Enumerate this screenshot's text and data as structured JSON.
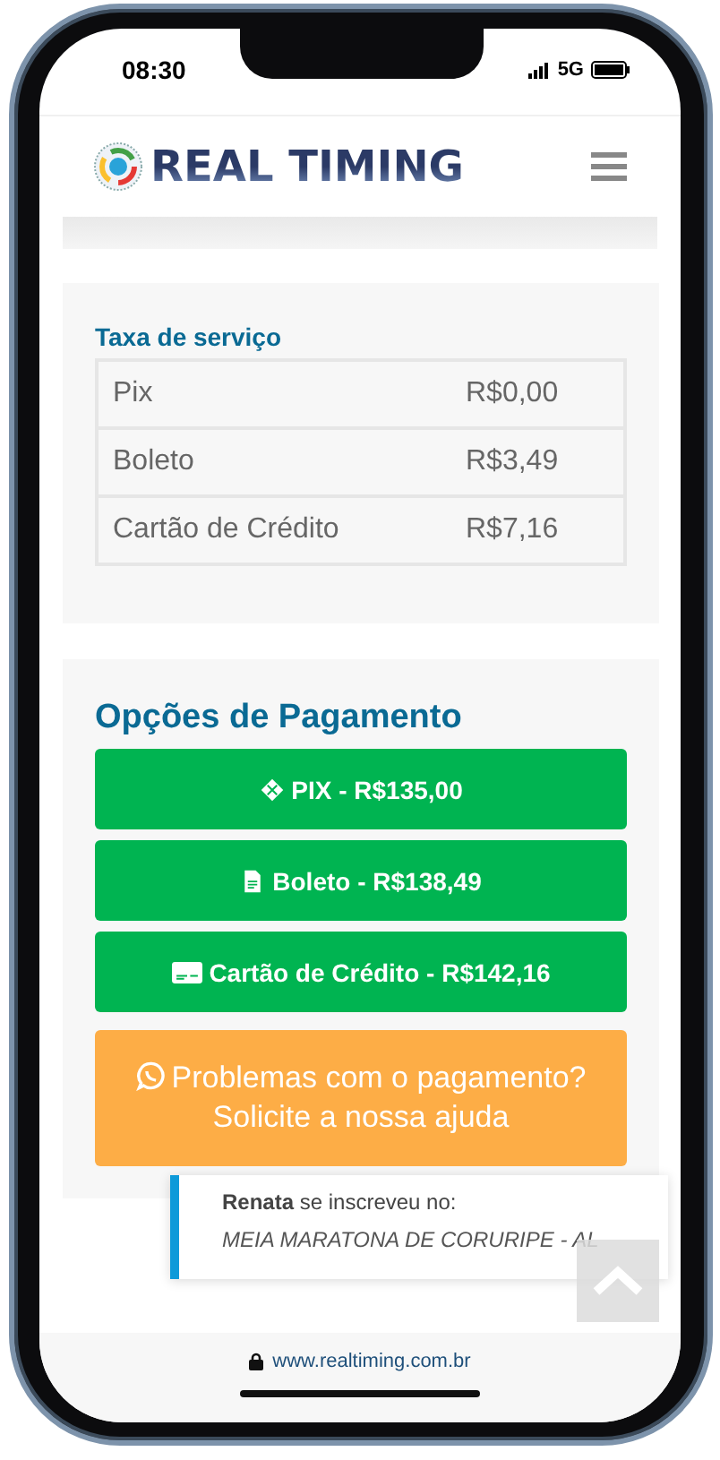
{
  "status_bar": {
    "time": "08:30",
    "network": "5G"
  },
  "header": {
    "logo": "REAL TIMING"
  },
  "service_fees": {
    "title": "Taxa de serviço",
    "rows": [
      {
        "method": "Pix",
        "fee": "R$0,00"
      },
      {
        "method": "Boleto",
        "fee": "R$3,49"
      },
      {
        "method": "Cartão de Crédito",
        "fee": "R$7,16"
      }
    ]
  },
  "payment_options": {
    "title": "Opções de Pagamento",
    "buttons": [
      {
        "kind": "pix",
        "label": "PIX - R$135,00"
      },
      {
        "kind": "boleto",
        "label": "Boleto - R$138,49"
      },
      {
        "kind": "card",
        "label": "Cartão de Crédito - R$142,16"
      }
    ],
    "help_button": {
      "label": "Problemas com o pagamento? Solicite a nossa ajuda"
    }
  },
  "toast": {
    "message": "**Renata** se inscreveu no:",
    "event": "MEIA MARATONA DE CORURIPE - AL"
  },
  "browser_bar": {
    "url": "www.realtiming.com.br"
  }
}
